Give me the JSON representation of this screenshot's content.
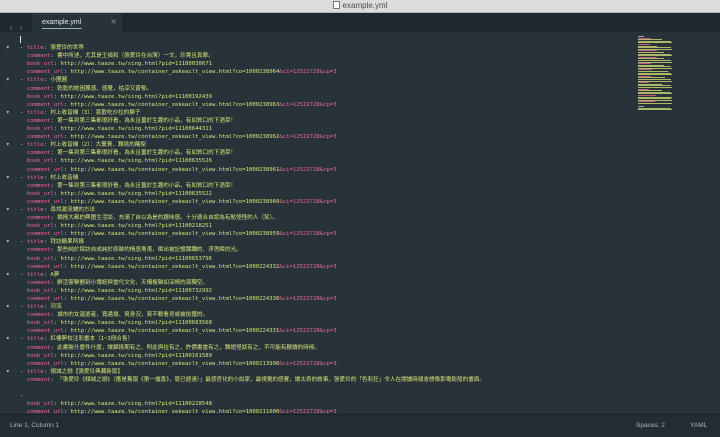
{
  "window": {
    "title": "example.yml"
  },
  "tab": {
    "label": "example.yml",
    "close": "×"
  },
  "nav": {
    "back": "‹",
    "forward": "›"
  },
  "status": {
    "position": "Line 1, Column 1",
    "spaces": "Spaces: 2",
    "syntax": "YAML"
  },
  "editor": {
    "lines": [
      {
        "t": "cursor"
      },
      {
        "t": "kv",
        "dash": true,
        "fold": true,
        "key": "title",
        "val": "張愛玲的世界"
      },
      {
        "t": "kv",
        "key": "comment",
        "val": "書中所述，尤其是王禎和〈張愛玲在台灣〉一文，珍貴且真摯。"
      },
      {
        "t": "kv",
        "key": "book_url",
        "val": "http://www.taaze.tw/sing.html?pid=11100030671"
      },
      {
        "t": "url",
        "key": "comment_url",
        "val": "http://www.taaze.tw/container_zekeaclt_view.html?co=1000238964",
        "tail": "&ci=12522728&cp=3"
      },
      {
        "t": "kv",
        "dash": true,
        "fold": true,
        "key": "title",
        "val": "小團圓"
      },
      {
        "t": "kv",
        "key": "comment",
        "val": "乾乾的她困篾感、感覺，枯涼又蒼郁。"
      },
      {
        "t": "kv",
        "key": "book_url",
        "val": "http://www.taaze.tw/sing.html?pid=11100192439"
      },
      {
        "t": "url",
        "key": "comment_url",
        "val": "http://www.taaze.tw/container_zekeaclt_view.html?co=1000238963",
        "tail": "&ci=12522728&cp=3"
      },
      {
        "t": "kv",
        "dash": true,
        "fold": true,
        "key": "title",
        "val": "村上收音機（3）：喜歡吃沙拉的獅子"
      },
      {
        "t": "kv",
        "key": "comment",
        "val": "第一集到第三集都很好看，為永且蓋於生趣的小品，有如質口的下酒菜！"
      },
      {
        "t": "kv",
        "key": "book_url",
        "val": "http://www.taaze.tw/sing.html?pid=11100644311"
      },
      {
        "t": "url",
        "key": "comment_url",
        "val": "http://www.taaze.tw/container_zekeaclt_view.html?co=1000238962",
        "tail": "&ci=12522728&cp=3"
      },
      {
        "t": "kv",
        "dash": true,
        "fold": true,
        "key": "title",
        "val": "村上收音機（2）：大蕪菁、難挑的酪梨"
      },
      {
        "t": "kv",
        "key": "comment",
        "val": "第一集到第三集都很好看，為永且蓋於生趣的小品，有如質口的下酒菜！"
      },
      {
        "t": "kv",
        "key": "book_url",
        "val": "http://www.taaze.tw/sing.html?pid=11100635526"
      },
      {
        "t": "url",
        "key": "comment_url",
        "val": "http://www.taaze.tw/container_zekeaclt_view.html?co=1000238961",
        "tail": "&ci=12522728&cp=3"
      },
      {
        "t": "kv",
        "dash": true,
        "fold": true,
        "key": "title",
        "val": "村上收音機"
      },
      {
        "t": "kv",
        "key": "comment",
        "val": "第一集到第三集都很好看，為永且蓋於生趣的小品，有如質口的下酒菜！"
      },
      {
        "t": "kv",
        "key": "book_url",
        "val": "http://www.taaze.tw/sing.html?pid=11100635522"
      },
      {
        "t": "url",
        "key": "comment_url",
        "val": "http://www.taaze.tw/container_zekeaclt_view.html?co=1000238960",
        "tail": "&ci=12522728&cp=3"
      },
      {
        "t": "kv",
        "dash": true,
        "fold": true,
        "key": "title",
        "val": "尋找激流鋪的方法"
      },
      {
        "t": "kv",
        "key": "comment",
        "val": "鎖撥大都的興圍生活談，充滿了自以為是的趣味感。十分適合自認為有點怪怪的人（笑）。"
      },
      {
        "t": "kv",
        "key": "book_url",
        "val": "http://www.taaze.tw/sing.html?pid=11100218251"
      },
      {
        "t": "url",
        "key": "comment_url",
        "val": "http://www.taaze.tw/container_zekeaclt_view.html?co=1000238959",
        "tail": "&ci=12522728&cp=3"
      },
      {
        "t": "kv",
        "dash": true,
        "fold": true,
        "key": "title",
        "val": "拜訪糖果阿姨"
      },
      {
        "t": "kv",
        "key": "comment",
        "val": "那些純於探訪自成純於原跡的情感角落，徵出被記憶蹂躪的、浮思瞬的光。"
      },
      {
        "t": "kv",
        "key": "book_url",
        "val": "http://www.taaze.tw/sing.html?pid=11100653796"
      },
      {
        "t": "url",
        "key": "comment_url",
        "val": "http://www.taaze.tw/container_zekeaclt_view.html?co=1000224332",
        "tail": "&ci=12522728&cp=3"
      },
      {
        "t": "kv",
        "dash": true,
        "fold": true,
        "key": "title",
        "val": "A夢"
      },
      {
        "t": "kv",
        "key": "comment",
        "val": "鮮活靈擊劃刻小傳統與當代文化，天構複雜如深情的孤獨空。"
      },
      {
        "t": "kv",
        "key": "book_url",
        "val": "http://www.taaze.tw/sing.html?pid=11100732992"
      },
      {
        "t": "url",
        "key": "comment_url",
        "val": "http://www.taaze.tw/container_zekeaclt_view.html?co=1000224330",
        "tail": "&ci=12522728&cp=3"
      },
      {
        "t": "kv",
        "dash": true,
        "fold": true,
        "key": "title",
        "val": "河流"
      },
      {
        "t": "kv",
        "key": "comment",
        "val": "城市的女還遊者，寬邁揚、寫身況，寫不驗看見或被撿獲的。"
      },
      {
        "t": "kv",
        "key": "book_url",
        "val": "http://www.taaze.tw/sing.html?pid=11100683568"
      },
      {
        "t": "url",
        "key": "comment_url",
        "val": "http://www.taaze.tw/container_zekeaclt_view.html?co=1000224331",
        "tail": "&ci=12522728&cp=3"
      },
      {
        "t": "kv",
        "dash": true,
        "fold": true,
        "key": "title",
        "val": "紅樓夢校注彩畫本（1~3冊合售）"
      },
      {
        "t": "kv",
        "key": "comment",
        "val": "此書裝什麼件什麼，讓錦挑期有之、則此與拉有之，許價書當有之，難語怪狀有之，不可能有厭讀的時候。"
      },
      {
        "t": "kv",
        "key": "book_url",
        "val": "http://www.taaze.tw/sing.html?pid=11100161589"
      },
      {
        "t": "url",
        "key": "comment_url",
        "val": "http://www.taaze.tw/container_zekeaclt_view.html?co=1000213998",
        "tail": "&ci=12522728&cp=3"
      },
      {
        "t": "kv",
        "dash": true,
        "fold": true,
        "key": "title",
        "val": "傾城之戀【張愛玲典藏新版】"
      },
      {
        "t": "kv",
        "key": "comment",
        "val": "「張愛玲《傾城之戀》（應是舊版《第一爐香》，恩已經遠）」最感官化的小說家，最視覺的感覺，讓太奇的敘事，張愛玲的「色彩狂」令人在閱讀時總會想像那電影般的畫面。"
      },
      {
        "t": "blank"
      },
      {
        "t": "dashonly"
      },
      {
        "t": "kv",
        "key": "book_url",
        "val": "http://www.taaze.tw/sing.html?pid=11100228548"
      },
      {
        "t": "url",
        "key": "comment_url",
        "val": "http://www.taaze.tw/container_zekeaclt_view.html?co=1000211000",
        "tail": "&ci=12522728&cp=3"
      }
    ]
  },
  "colors": {
    "background": "#283239",
    "key": "#f0699a",
    "string": "#d9e57a",
    "text": "#c4d0d6"
  }
}
